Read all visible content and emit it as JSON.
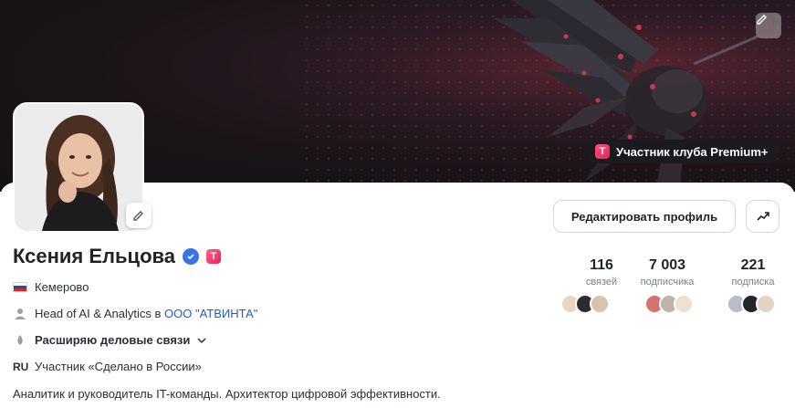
{
  "cover": {
    "club_badge_label": "Участник клуба Premium+",
    "club_badge_letter": "T",
    "edit_icon": "pencil-icon"
  },
  "profile": {
    "name": "Ксения Ельцова",
    "verified_icon": "verified-check-icon",
    "premium_letter": "T",
    "city": "Кемерово",
    "position_prefix": "Head of AI & Analytics в ",
    "company": "ООО \"АТВИНТА\"",
    "goal": "Расширяю деловые связи",
    "lang_code": "RU",
    "program": "Участник «Сделано в России»",
    "bio": "Аналитик и руководитель IT-команды. Архитектор цифровой эффективности."
  },
  "actions": {
    "edit_profile_label": "Редактировать профиль",
    "stats_icon": "trending-up-icon"
  },
  "stats": [
    {
      "value": "116",
      "label": "связей"
    },
    {
      "value": "7 003",
      "label": "подписчика"
    },
    {
      "value": "221",
      "label": "подписка"
    }
  ],
  "colors": {
    "accent_blue": "#1f5bd8",
    "verified_blue": "#3b74e6",
    "premium_pink": "#e8245a"
  }
}
